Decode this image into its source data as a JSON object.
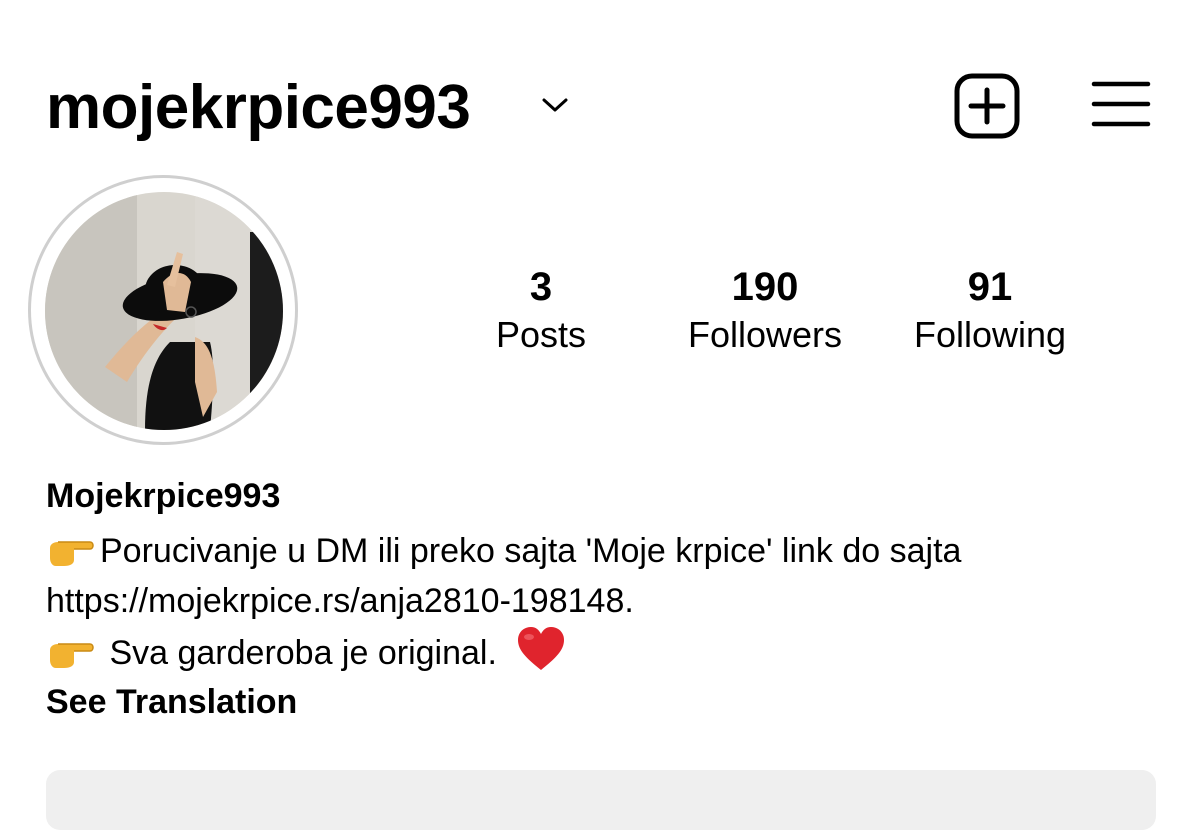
{
  "header": {
    "username": "mojekrpice993",
    "dropdown_icon": "chevron-down-icon",
    "create_icon": "plus-square-icon",
    "menu_icon": "hamburger-menu-icon"
  },
  "profile": {
    "avatar_icon": "profile-avatar",
    "stats": [
      {
        "value": "3",
        "label": "Posts"
      },
      {
        "value": "190",
        "label": "Followers"
      },
      {
        "value": "91",
        "label": "Following"
      }
    ]
  },
  "bio": {
    "display_name": "Mojekrpice993",
    "line1": "Porucivanje u DM ili preko sajta 'Moje krpice' link do sajta",
    "line2": "https://mojekrpice.rs/anja2810-198148.",
    "line3": " Sva garderoba je original.",
    "see_translation": "See Translation"
  },
  "colors": {
    "text": "#000000",
    "avatar_ring": "#cfcfcf",
    "button_bg": "#efefef",
    "heart": "#e0242d",
    "pointing_hand": "#f2b230"
  }
}
